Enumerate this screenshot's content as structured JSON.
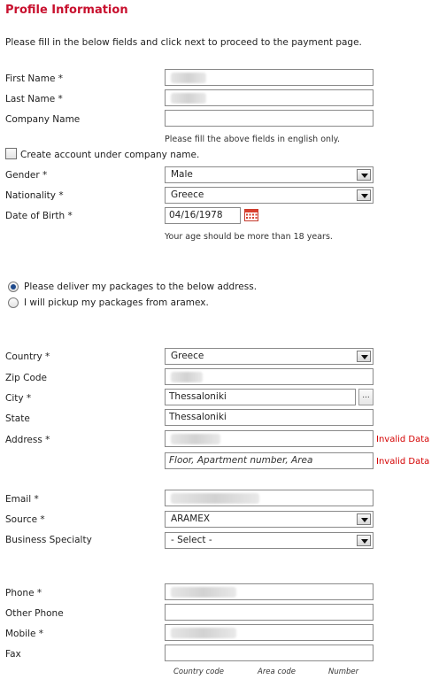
{
  "page_title": "Profile Information",
  "intro": "Please fill in the below fields and click next to proceed to the payment page.",
  "personal": {
    "first_name_label": "First Name  *",
    "last_name_label": "Last Name  *",
    "company_name_label": "Company Name",
    "company_name_value": "",
    "english_note": "Please fill the above fields in english only.",
    "create_account_label": "Create account under company name.",
    "create_account_checked": false,
    "gender_label": "Gender  *",
    "gender_value": "Male",
    "nationality_label": "Nationality *",
    "nationality_value": "Greece",
    "dob_label": "Date of Birth *",
    "dob_value": "04/16/1978",
    "age_note": "Your age should be more than 18 years."
  },
  "delivery": {
    "option_deliver": "Please deliver my packages to the below address.",
    "option_pickup": "I will pickup my packages from aramex.",
    "selected": "deliver"
  },
  "address": {
    "country_label": "Country *",
    "country_value": "Greece",
    "zip_label": "Zip Code",
    "city_label": "City *",
    "city_value": "Thessaloniki",
    "city_lookup_label": "...",
    "state_label": "State",
    "state_value": "Thessaloniki",
    "address_label": "Address *",
    "address_error": "Invalid Data",
    "address2_placeholder": "Floor, Apartment number, Area",
    "address2_error": "Invalid Data"
  },
  "contact": {
    "email_label": "Email  *",
    "source_label": "Source  *",
    "source_value": "ARAMEX",
    "business_label": "Business Specialty",
    "business_value": "- Select -",
    "phone_label": "Phone *",
    "other_phone_label": "Other Phone",
    "other_phone_value": "",
    "mobile_label": "Mobile *",
    "fax_label": "Fax",
    "fax_value": "",
    "phone_parts": {
      "country_code": "Country code",
      "area_code": "Area code",
      "number": "Number"
    }
  },
  "colors": {
    "title": "#c8102e",
    "error": "#d40000",
    "radio_selected": "#1f4a8c"
  },
  "icons": {
    "calendar": "calendar-icon",
    "dropdown": "chevron-down-icon"
  }
}
